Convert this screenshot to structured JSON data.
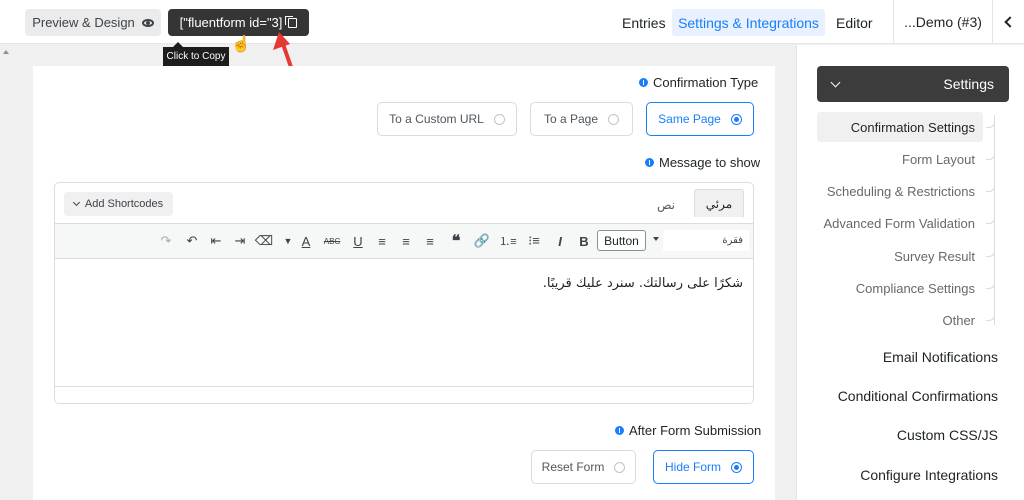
{
  "topbar": {
    "preview_label": "Preview & Design",
    "shortcode_label": "[\"fluentform id=\"3]",
    "tooltip": "Click to Copy",
    "nav": {
      "entries": "Entries",
      "settings": "Settings & Integrations",
      "editor": "Editor"
    },
    "form_title": "...Demo (#3)",
    "accent_color": "#1a7efb"
  },
  "confirmation": {
    "label": "Confirmation Type",
    "options": [
      {
        "label": "To a Custom URL",
        "selected": false
      },
      {
        "label": "To a Page",
        "selected": false
      },
      {
        "label": "Same Page",
        "selected": true
      }
    ]
  },
  "message": {
    "label": "Message to show",
    "add_shortcodes": "Add Shortcodes",
    "tab_visual": "مرئي",
    "tab_text": "نص",
    "toolbar": {
      "button_select": "Button",
      "format_select": "فقرة"
    },
    "content": "شكرًا على رسالتك. سنرد عليك قريبًا."
  },
  "after_submit": {
    "label": "After Form Submission",
    "options": [
      {
        "label": "Reset Form",
        "selected": false
      },
      {
        "label": "Hide Form",
        "selected": true
      }
    ]
  },
  "sidebar": {
    "header": "Settings",
    "sub_items": [
      "Confirmation Settings",
      "Form Layout",
      "Scheduling & Restrictions",
      "Advanced Form Validation",
      "Survey Result",
      "Compliance Settings",
      "Other"
    ],
    "active_sub_item": "Confirmation Settings",
    "main_items": [
      "Email Notifications",
      "Conditional Confirmations",
      "Custom CSS/JS",
      "Configure Integrations"
    ]
  }
}
